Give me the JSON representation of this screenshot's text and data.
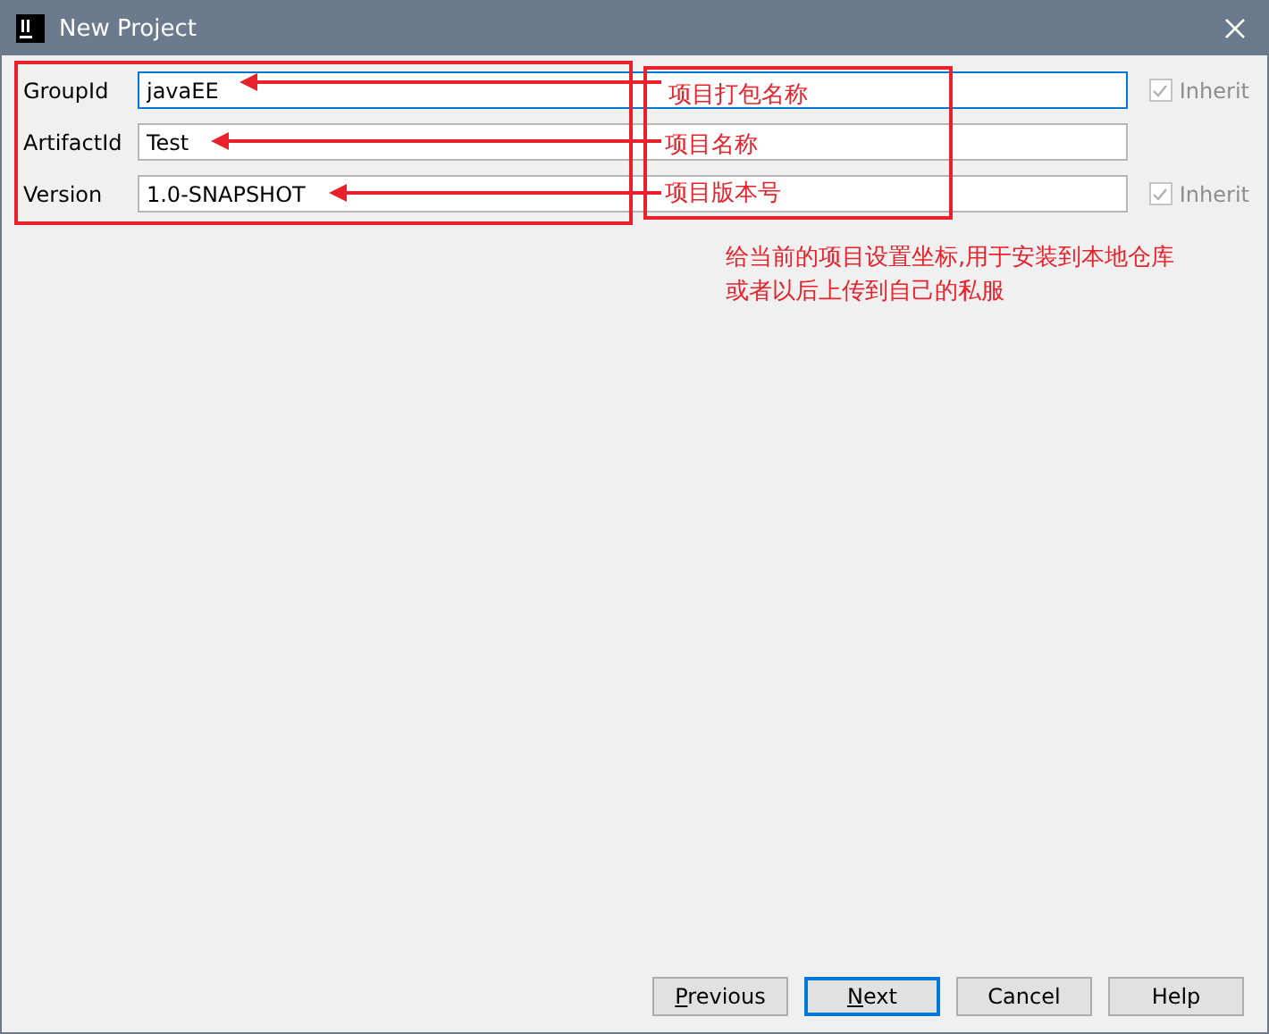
{
  "window": {
    "title": "New Project"
  },
  "fields": [
    {
      "label": "GroupId",
      "value": "javaEE",
      "focused": true,
      "inherit": {
        "label": "Inherit",
        "checked": true,
        "disabled": true
      }
    },
    {
      "label": "ArtifactId",
      "value": "Test",
      "focused": false
    },
    {
      "label": "Version",
      "value": "1.0-SNAPSHOT",
      "focused": false,
      "inherit": {
        "label": "Inherit",
        "checked": true,
        "disabled": true
      }
    }
  ],
  "annotations": {
    "notes": [
      "项目打包名称",
      "项目名称",
      "项目版本号"
    ],
    "description": [
      "给当前的项目设置坐标,用于安装到本地仓库",
      "或者以后上传到自己的私服"
    ]
  },
  "buttons": [
    {
      "label": "Previous",
      "default": false,
      "mnemonic_underlined": true
    },
    {
      "label": "Next",
      "default": true,
      "mnemonic_underlined": true
    },
    {
      "label": "Cancel",
      "default": false,
      "mnemonic_underlined": false
    },
    {
      "label": "Help",
      "default": false,
      "mnemonic_underlined": false
    }
  ]
}
